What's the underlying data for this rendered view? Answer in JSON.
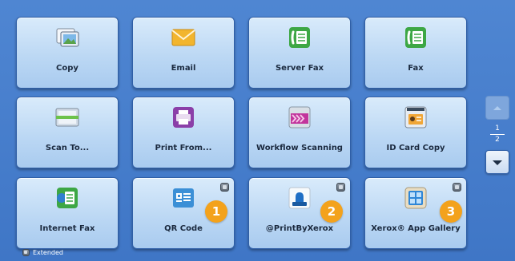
{
  "apps": [
    {
      "label": "Copy",
      "icon": "copy-icon"
    },
    {
      "label": "Email",
      "icon": "email-icon"
    },
    {
      "label": "Server Fax",
      "icon": "server-fax-icon"
    },
    {
      "label": "Fax",
      "icon": "fax-icon"
    },
    {
      "label": "Scan To...",
      "icon": "scan-icon"
    },
    {
      "label": "Print From...",
      "icon": "printer-icon"
    },
    {
      "label": "Workflow Scanning",
      "icon": "workflow-scanning-icon"
    },
    {
      "label": "ID Card Copy",
      "icon": "id-card-icon"
    },
    {
      "label": "Internet Fax",
      "icon": "internet-fax-icon"
    },
    {
      "label": "QR Code",
      "icon": "qr-code-icon",
      "extended": true,
      "callout": "1"
    },
    {
      "label": "@PrintByXerox",
      "icon": "print-by-xerox-icon",
      "extended": true,
      "callout": "2"
    },
    {
      "label": "Xerox® App Gallery",
      "icon": "app-gallery-icon",
      "extended": true,
      "callout": "3"
    }
  ],
  "pagination": {
    "current": "1",
    "total": "2"
  },
  "legend": {
    "extended_label": "Extended"
  },
  "colors": {
    "callout": "#f3a21c",
    "tile_top": "#d9ebfb",
    "tile_bottom": "#a9cbef",
    "background": "#4f86d2"
  }
}
